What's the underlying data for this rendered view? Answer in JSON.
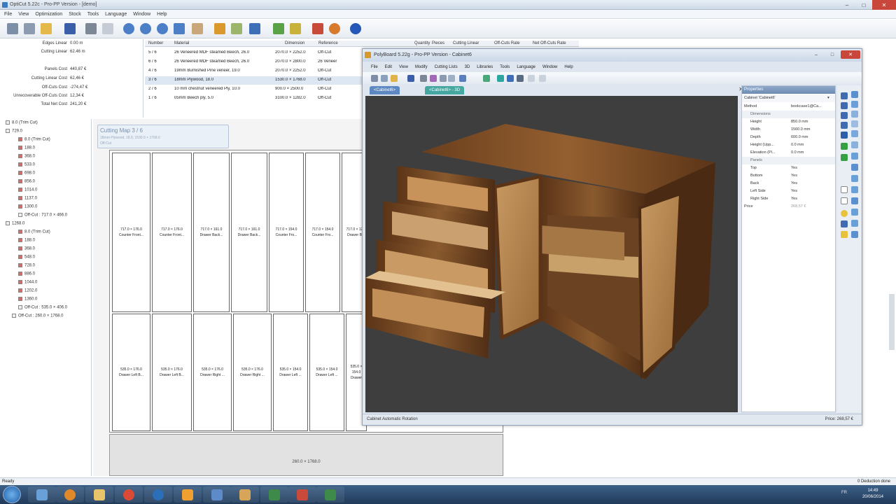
{
  "app": {
    "title": "OptiCut 5.22c - Pro-PP Version - [demo]"
  },
  "menu": [
    "File",
    "View",
    "Optimization",
    "Stock",
    "Tools",
    "Language",
    "Window",
    "Help"
  ],
  "summary": {
    "rows": [
      {
        "label": "Edges Linear",
        "value": "0.00 m"
      },
      {
        "label": "Cutting Linear",
        "value": "62.46 m"
      },
      {
        "label": "Panels Cost",
        "value": "440,87 €"
      },
      {
        "label": "Cutting Linear Cost",
        "value": "62,46 €"
      },
      {
        "label": "Off-Cuts Cost",
        "value": "-274,47 €"
      },
      {
        "label": "Unrecoverable Off-Cuts Cost",
        "value": "12,34 €"
      },
      {
        "label": "Total Net Cost",
        "value": "241,20 €"
      }
    ]
  },
  "materials": {
    "headers": [
      "Number",
      "Material",
      "Dimension",
      "Reference",
      "Quantity",
      "Pieces",
      "Cutting Linear",
      "Off-Cuts Rate",
      "Net Off-Cuts Rate"
    ],
    "rows": [
      {
        "number": "5 / 6",
        "material": "26 Veneered MDF steamed Beech, 26.0",
        "dimension": "2070.0 × 2252.0",
        "reference": "Off-Cut"
      },
      {
        "number": "6 / 6",
        "material": "26 Veneered MDF steamed Beech, 26.0",
        "dimension": "2070.0 × 2800.0",
        "reference": "26 Veneer"
      },
      {
        "number": "4 / 6",
        "material": "19mm Burnished Pine veneer, 19.0",
        "dimension": "2070.0 × 2252.0",
        "reference": "Off-Cut"
      },
      {
        "number": "3 / 6",
        "material": "18mm Plywood, 18.0",
        "dimension": "1530.0 × 1768.0",
        "reference": "Off-Cut",
        "selected": true
      },
      {
        "number": "2 / 6",
        "material": "10 mm chestnut veneered Ply, 10.0",
        "dimension": "900.0 × 2500.0",
        "reference": "Off-Cut"
      },
      {
        "number": "1 / 6",
        "material": "05mm Beech ply, 5.0",
        "dimension": "3100.0 × 1282.0",
        "reference": "Off-Cut"
      }
    ]
  },
  "tree": [
    {
      "label": "8.0 (Trim Cut)",
      "indent": 0
    },
    {
      "label": "729.0",
      "indent": 0
    },
    {
      "label": "8.0 (Trim Cut)",
      "indent": 2
    },
    {
      "label": "188.0",
      "indent": 2
    },
    {
      "label": "368.0",
      "indent": 2
    },
    {
      "label": "533.0",
      "indent": 2
    },
    {
      "label": "698.0",
      "indent": 2
    },
    {
      "label": "856.0",
      "indent": 2
    },
    {
      "label": "1014.0",
      "indent": 2
    },
    {
      "label": "1137.0",
      "indent": 2
    },
    {
      "label": "1300.0",
      "indent": 2
    },
    {
      "label": "Off-Cut : 717.0 × 466.0",
      "indent": 2
    },
    {
      "label": "1268.0",
      "indent": 0
    },
    {
      "label": "8.0 (Trim Cut)",
      "indent": 2
    },
    {
      "label": "188.0",
      "indent": 2
    },
    {
      "label": "368.0",
      "indent": 2
    },
    {
      "label": "548.0",
      "indent": 2
    },
    {
      "label": "728.0",
      "indent": 2
    },
    {
      "label": "886.0",
      "indent": 2
    },
    {
      "label": "1044.0",
      "indent": 2
    },
    {
      "label": "1202.0",
      "indent": 2
    },
    {
      "label": "1360.0",
      "indent": 2
    },
    {
      "label": "Off-Cut : 535.0 × 406.0",
      "indent": 2
    },
    {
      "label": "Off-Cut : 260.0 × 1768.0",
      "indent": 1
    }
  ],
  "cutting_map": {
    "title": "Cutting Map 3 / 6",
    "subtitle": "18mm Plywood, 18.0, 1530.0 × 1768.0",
    "type": "Off-Cut",
    "top_pieces": [
      {
        "dim": "717.0 × 176.0",
        "name": "Counter Front..."
      },
      {
        "dim": "717.0 × 176.0",
        "name": "Counter Front..."
      },
      {
        "dim": "717.0 × 161.0",
        "name": "Drawer Back..."
      },
      {
        "dim": "717.0 × 161.0",
        "name": "Drawer Back..."
      },
      {
        "dim": "717.0 × 154.0",
        "name": "Counter Fro..."
      },
      {
        "dim": "717.0 × 154.0",
        "name": "Counter Fro..."
      },
      {
        "dim": "717.0 × 129.0",
        "name": "Drawer Ba..."
      }
    ],
    "bottom_pieces": [
      {
        "dim": "535.0 × 176.0",
        "name": "Drawer Left B..."
      },
      {
        "dim": "535.0 × 176.0",
        "name": "Drawer Left B..."
      },
      {
        "dim": "535.0 × 176.0",
        "name": "Drawer Right ..."
      },
      {
        "dim": "535.0 × 176.0",
        "name": "Drawer Right ..."
      },
      {
        "dim": "535.0 × 154.0",
        "name": "Drawer Left ..."
      },
      {
        "dim": "535.0 × 154.0",
        "name": "Drawer Left ..."
      },
      {
        "dim": "535.0 × 154.0",
        "name": "Drawer"
      }
    ],
    "offcut": "260.0 × 1768.0"
  },
  "polyboard": {
    "title": "PolyBoard 5.22g - Pro-PP Version - Cabinet6",
    "menu": [
      "File",
      "Edit",
      "View",
      "Modify",
      "Cutting Lists",
      "3D",
      "Libraries",
      "Tools",
      "Language",
      "Window",
      "Help"
    ],
    "tabs": [
      "<Cabinet6>",
      "<Cabinet6> - 3D"
    ],
    "properties": {
      "header": "Properties",
      "object": "Cabinet 'Cabinet6'",
      "method_label": "Method",
      "method_value": "bookcase1@Ca...",
      "group_dimensions": "Dimensions",
      "rows": [
        {
          "k": "Height",
          "v": "850.0 mm"
        },
        {
          "k": "Width",
          "v": "1560.0 mm"
        },
        {
          "k": "Depth",
          "v": "600.0 mm"
        },
        {
          "k": "Height (Upp...",
          "v": "0.0 mm"
        },
        {
          "k": "Elevation (Pl...",
          "v": "0.0 mm"
        }
      ],
      "group_panels": "Panels",
      "panels": [
        {
          "k": "Top",
          "v": "Yes"
        },
        {
          "k": "Bottom",
          "v": "Yes"
        },
        {
          "k": "Back",
          "v": "Yes"
        },
        {
          "k": "Left Side",
          "v": "Yes"
        },
        {
          "k": "Right Side",
          "v": "Yes"
        }
      ],
      "price_label": "Price",
      "price_value": "268,57 €"
    },
    "status_left": "Cabinet Automatic Rotation",
    "status_right": "Price: 268,57 €"
  },
  "status": {
    "left": "Ready",
    "right": "0 Deduction done"
  },
  "clock": {
    "time": "14:49",
    "date": "20/06/2014"
  },
  "tray_lang": "FR"
}
